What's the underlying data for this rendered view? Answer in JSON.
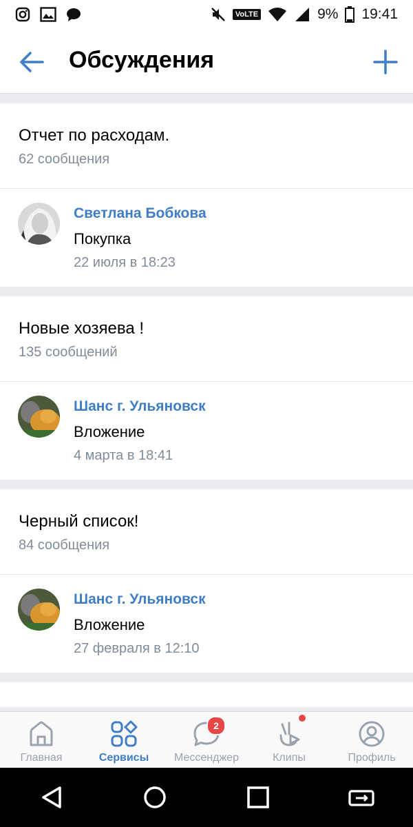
{
  "status_bar": {
    "battery": "9%",
    "time": "19:41",
    "volte": "VoLTE"
  },
  "header": {
    "title": "Обсуждения"
  },
  "topics": [
    {
      "title": "Отчет по расходам.",
      "count": "62 сообщения",
      "last_post": {
        "author": "Светлана Бобкова",
        "text": "Покупка",
        "date": "22 июля в 18:23"
      }
    },
    {
      "title": "Новые хозяева !",
      "count": "135 сообщений",
      "last_post": {
        "author": "Шанс г. Ульяновск",
        "text": "Вложение",
        "date": "4 марта в 18:41"
      }
    },
    {
      "title": "Черный список!",
      "count": "84 сообщения",
      "last_post": {
        "author": "Шанс г. Ульяновск",
        "text": "Вложение",
        "date": "27 февраля в 12:10"
      }
    }
  ],
  "tabbar": {
    "home": "Главная",
    "services": "Сервисы",
    "messenger": "Мессенджер",
    "messenger_badge": "2",
    "clips": "Клипы",
    "profile": "Профиль"
  },
  "colors": {
    "accent": "#3f7ec4",
    "badge": "#e64646",
    "secondary_text": "#818c99"
  }
}
